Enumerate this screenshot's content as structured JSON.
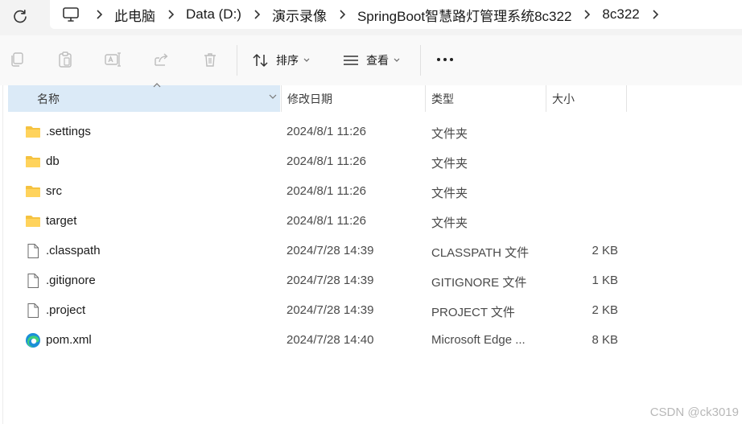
{
  "breadcrumb": {
    "items": [
      "此电脑",
      "Data (D:)",
      "演示录像",
      "SpringBoot智慧路灯管理系统8c322",
      "8c322"
    ]
  },
  "toolbar": {
    "sort_label": "排序",
    "view_label": "查看"
  },
  "columns": {
    "name": "名称",
    "date": "修改日期",
    "type": "类型",
    "size": "大小"
  },
  "files": [
    {
      "name": ".settings",
      "date": "2024/8/1 11:26",
      "type": "文件夹",
      "size": "",
      "icon": "folder-icon"
    },
    {
      "name": "db",
      "date": "2024/8/1 11:26",
      "type": "文件夹",
      "size": "",
      "icon": "folder-icon"
    },
    {
      "name": "src",
      "date": "2024/8/1 11:26",
      "type": "文件夹",
      "size": "",
      "icon": "folder-icon"
    },
    {
      "name": "target",
      "date": "2024/8/1 11:26",
      "type": "文件夹",
      "size": "",
      "icon": "folder-icon"
    },
    {
      "name": ".classpath",
      "date": "2024/7/28 14:39",
      "type": "CLASSPATH 文件",
      "size": "2 KB",
      "icon": "file-icon"
    },
    {
      "name": ".gitignore",
      "date": "2024/7/28 14:39",
      "type": "GITIGNORE 文件",
      "size": "1 KB",
      "icon": "file-icon"
    },
    {
      "name": ".project",
      "date": "2024/7/28 14:39",
      "type": "PROJECT 文件",
      "size": "2 KB",
      "icon": "file-icon"
    },
    {
      "name": "pom.xml",
      "date": "2024/7/28 14:40",
      "type": "Microsoft Edge ...",
      "size": "8 KB",
      "icon": "edge-icon"
    }
  ],
  "watermark": "CSDN @ck3019",
  "colors": {
    "folder": "#f5c240",
    "selected_header": "#dbeaf7"
  }
}
